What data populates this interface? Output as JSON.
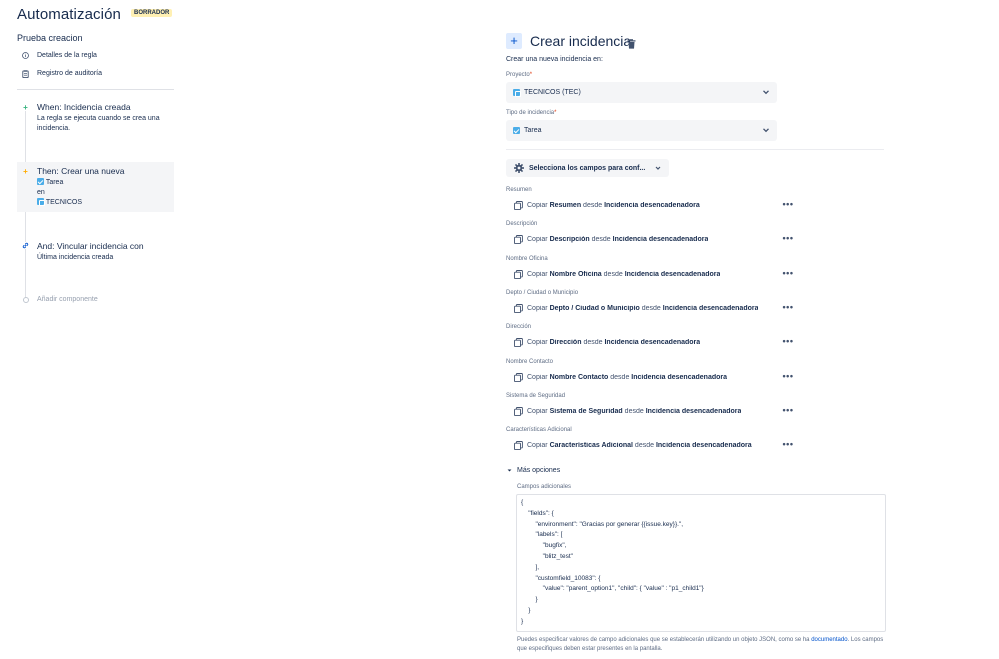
{
  "header": {
    "title": "Automatización",
    "badge": "BORRADOR",
    "rule_name": "Prueba creacion"
  },
  "sidebar": {
    "links": [
      {
        "label": "Detalles de la regla",
        "icon": "info-icon"
      },
      {
        "label": "Registro de auditoría",
        "icon": "clipboard-icon"
      }
    ]
  },
  "timeline": {
    "trigger": {
      "title": "When: Incidencia creada",
      "desc": "La regla se ejecuta cuando se crea una incidencia."
    },
    "action": {
      "title": "Then: Crear una nueva",
      "type": "Tarea",
      "connector": "en",
      "project": "TECNICOS"
    },
    "branch": {
      "title": "And: Vincular incidencia con",
      "desc": "Última incidencia creada"
    },
    "add_component": "Añadir componente"
  },
  "panel": {
    "title": "Crear incidencia",
    "create_in": "Crear una nueva incidencia en:",
    "project_label": "Proyecto",
    "project_value": "TECNICOS (TEC)",
    "issue_type_label": "Tipo de incidencia",
    "issue_type_value": "Tarea",
    "required_mark": "*",
    "fields_button": "Selecciona los campos para conf...",
    "copy_word": "Copiar",
    "from_word": "desde",
    "source": "Incidencia desencadenadora",
    "more": "•••",
    "fields": [
      {
        "label": "Resumen",
        "field": "Resumen"
      },
      {
        "label": "Descripción",
        "field": "Descripción"
      },
      {
        "label": "Nombre Oficina",
        "field": "Nombre Oficina"
      },
      {
        "label": "Depto / Ciudad o Municipio",
        "field": "Depto / Ciudad o Municipio"
      },
      {
        "label": "Dirección",
        "field": "Dirección"
      },
      {
        "label": "Nombre Contacto",
        "field": "Nombre Contacto"
      },
      {
        "label": "Sistema de Seguridad",
        "field": "Sistema de Seguridad"
      },
      {
        "label": "Características Adicional",
        "field": "Características Adicional"
      }
    ],
    "more_options": "Más opciones",
    "extra_fields_label": "Campos adicionales",
    "json": "{\n    \"fields\": {\n        \"environment\": \"Gracias por generar {{issue.key}}.\",\n        \"labels\": [\n            \"bugfix\",\n            \"blitz_test\"\n        ],\n        \"customfield_10083\": {\n            \"value\": \"parent_option1\", \"child\": { \"value\" : \"p1_child1\"}\n        }\n    }\n}",
    "help_text_1": "Puedes especificar valores de campo adicionales que se establecerán utilizando un objeto JSON, como se ha ",
    "help_link": "documentado",
    "help_text_2": ". Los campos que especifiques deben estar presentes en la pantalla."
  },
  "colors": {
    "accent": "#0052cc",
    "trigger": "#36b37e",
    "action": "#ffab00",
    "badge_bg": "#fff0b3"
  }
}
